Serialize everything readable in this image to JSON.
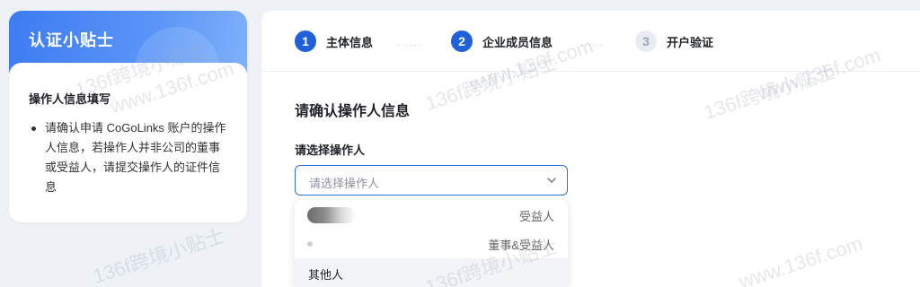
{
  "tips": {
    "title": "认证小贴士",
    "subtitle": "操作人信息填写",
    "items": [
      "请确认申请 CoGoLinks 账户的操作人信息，若操作人并非公司的董事或受益人，请提交操作人的证件信息"
    ]
  },
  "stepper": {
    "steps": [
      {
        "number": "1",
        "label": "主体信息",
        "state": "active"
      },
      {
        "number": "2",
        "label": "企业成员信息",
        "state": "active"
      },
      {
        "number": "3",
        "label": "开户验证",
        "state": "inactive"
      }
    ],
    "dots": "······"
  },
  "form": {
    "section_title": "请确认操作人信息",
    "field_label": "请选择操作人",
    "select_placeholder": "请选择操作人"
  },
  "dropdown": {
    "options": [
      {
        "name": "",
        "role": "受益人",
        "redacted": true
      },
      {
        "name": "",
        "role": "董事&受益人",
        "redacted": true
      },
      {
        "name": "其他人",
        "role": "",
        "redacted": false
      }
    ]
  },
  "watermark": {
    "text": "136f跨境小贴士",
    "url": "www.136f.com"
  },
  "colors": {
    "accent": "#2060d8",
    "header_gradient_start": "#3d7bf2",
    "header_gradient_end": "#7fb0fb"
  }
}
